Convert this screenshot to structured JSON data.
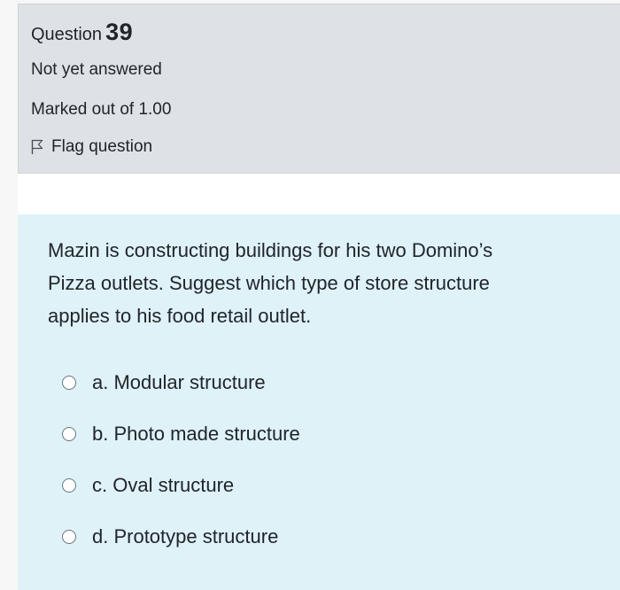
{
  "question": {
    "prefix": "Question",
    "number": "39",
    "state": "Not yet answered",
    "grade": "Marked out of 1.00",
    "flag_label": "Flag question",
    "text": "Mazin is constructing buildings for his two Domino’s Pizza outlets. Suggest which type of store structure applies to his food retail outlet.",
    "answers": [
      {
        "label": "a. Modular structure"
      },
      {
        "label": "b. Photo made structure"
      },
      {
        "label": "c. Oval structure"
      },
      {
        "label": "d. Prototype structure"
      }
    ]
  },
  "colors": {
    "info_bg": "#dee2e6",
    "content_bg": "#def2f8",
    "text": "#212529"
  }
}
